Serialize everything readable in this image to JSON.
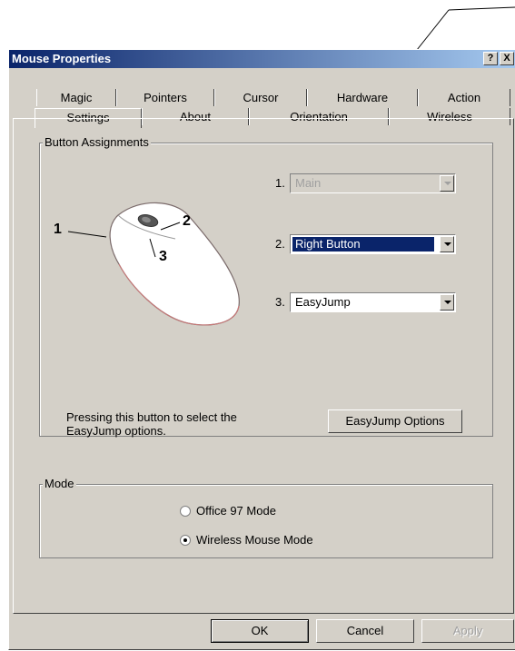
{
  "dialog": {
    "title": "Mouse Properties",
    "help_label": "?",
    "close_label": "X"
  },
  "tabs_row1": [
    "Magic",
    "Pointers",
    "Cursor",
    "Hardware",
    "Action"
  ],
  "tabs_row2": [
    "Settings",
    "About",
    "Orientation",
    "Wireless"
  ],
  "button_assignments": {
    "group_label": "Button  Assignments",
    "mouse_callouts": [
      "1",
      "2",
      "3"
    ],
    "rows": [
      {
        "number": "1.",
        "value": "Main",
        "state": "disabled"
      },
      {
        "number": "2.",
        "value": "Right Button",
        "state": "selected"
      },
      {
        "number": "3.",
        "value": "EasyJump",
        "state": "normal"
      }
    ],
    "help_text_line1": "Pressing this button to select the",
    "help_text_line2": "EasyJump options.",
    "options_button_label": "EasyJump Options"
  },
  "mode": {
    "group_label": "Mode",
    "options": [
      {
        "label": "Office 97 Mode",
        "selected": false
      },
      {
        "label": "Wireless Mouse Mode",
        "selected": true
      }
    ]
  },
  "footer": {
    "ok_label": "OK",
    "cancel_label": "Cancel",
    "apply_label": "Apply"
  },
  "colors": {
    "title_bar": "#0a246a",
    "face": "#d4d0c8",
    "selection": "#0a246a"
  }
}
